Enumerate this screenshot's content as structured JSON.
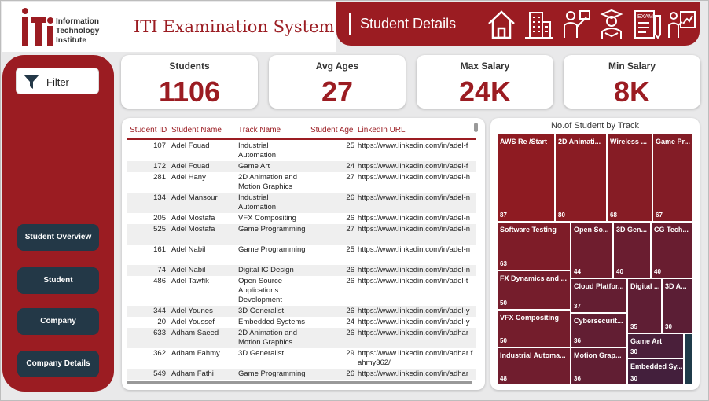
{
  "header": {
    "logo_text": [
      "Information",
      "Technology",
      "Institute"
    ],
    "app_title": "ITI Examination System",
    "page_title": "Student Details",
    "nav_icons": [
      "home-icon",
      "building-icon",
      "instructor-icon",
      "student-icon",
      "exam-icon",
      "presenter-icon"
    ]
  },
  "sidebar": {
    "filter_label": "Filter",
    "nav": [
      "Student Overview",
      "Student",
      "Company",
      "Company Details"
    ]
  },
  "kpis": [
    {
      "label": "Students",
      "value": "1106"
    },
    {
      "label": "Avg Ages",
      "value": "27"
    },
    {
      "label": "Max Salary",
      "value": "24K"
    },
    {
      "label": "Min Salary",
      "value": "8K"
    }
  ],
  "table": {
    "headers": [
      "Student ID",
      "Student Name",
      "Track Name",
      "Student Age",
      "LinkedIn URL"
    ],
    "rows": [
      {
        "id": "107",
        "name": "Adel Fouad",
        "track": "Industrial Automation",
        "age": "25",
        "url": "https://www.linkedin.com/in/adel-f"
      },
      {
        "id": "172",
        "name": "Adel Fouad",
        "track": "Game Art",
        "age": "24",
        "url": "https://www.linkedin.com/in/adel-f"
      },
      {
        "id": "281",
        "name": "Adel Hany",
        "track": "2D Animation and Motion Graphics",
        "age": "27",
        "url": "https://www.linkedin.com/in/adel-h"
      },
      {
        "id": "134",
        "name": "Adel Mansour",
        "track": "Industrial Automation",
        "age": "26",
        "url": "https://www.linkedin.com/in/adel-n"
      },
      {
        "id": "205",
        "name": "Adel Mostafa",
        "track": "VFX Compositing",
        "age": "26",
        "url": "https://www.linkedin.com/in/adel-n"
      },
      {
        "id": "525",
        "name": "Adel Mostafa",
        "track": "Game Programming",
        "age": "27",
        "url": "https://www.linkedin.com/in/adel-n"
      },
      {
        "id": "161",
        "name": "Adel Nabil",
        "track": "Game Programming",
        "age": "25",
        "url": "https://www.linkedin.com/in/adel-n"
      },
      {
        "id": "74",
        "name": "Adel Nabil",
        "track": "Digital IC Design",
        "age": "26",
        "url": "https://www.linkedin.com/in/adel-n"
      },
      {
        "id": "486",
        "name": "Adel Tawfik",
        "track": "Open Source Applications Development",
        "age": "26",
        "url": "https://www.linkedin.com/in/adel-t"
      },
      {
        "id": "344",
        "name": "Adel Younes",
        "track": "3D Generalist",
        "age": "26",
        "url": "https://www.linkedin.com/in/adel-y"
      },
      {
        "id": "20",
        "name": "Adel Youssef",
        "track": "Embedded Systems",
        "age": "24",
        "url": "https://www.linkedin.com/in/adel-y"
      },
      {
        "id": "633",
        "name": "Adham Saeed",
        "track": "2D Animation and Motion Graphics",
        "age": "26",
        "url": "https://www.linkedin.com/in/adhar"
      },
      {
        "id": "362",
        "name": "Adham Fahmy",
        "track": "3D Generalist",
        "age": "29",
        "url": "https://www.linkedin.com/in/adhar fahmy362/"
      },
      {
        "id": "549",
        "name": "Adham Fathi",
        "track": "Game Programming",
        "age": "26",
        "url": "https://www.linkedin.com/in/adhar"
      }
    ]
  },
  "chart_data": {
    "type": "treemap",
    "title": "No.of Student by Track",
    "cells": [
      {
        "label": "AWS Re /Start",
        "value": 87,
        "color": "#8e1b22"
      },
      {
        "label": "2D Animati...",
        "value": 80,
        "color": "#8a1c24"
      },
      {
        "label": "Wireless ...",
        "value": 68,
        "color": "#861c25"
      },
      {
        "label": "Game Pr...",
        "value": 67,
        "color": "#831c26"
      },
      {
        "label": "Software Testing",
        "value": 63,
        "color": "#7e1c28"
      },
      {
        "label": "Open So...",
        "value": 44,
        "color": "#6f1d2e"
      },
      {
        "label": "3D Gen...",
        "value": 40,
        "color": "#6a1d30"
      },
      {
        "label": "CG Tech...",
        "value": 40,
        "color": "#691d30"
      },
      {
        "label": "FX Dynamics and ...",
        "value": 50,
        "color": "#751d2c"
      },
      {
        "label": "Cloud Platfor...",
        "value": 37,
        "color": "#641e32"
      },
      {
        "label": "Digital ...",
        "value": 35,
        "color": "#5f1e34"
      },
      {
        "label": "3D A...",
        "value": 30,
        "color": "#5b1e35"
      },
      {
        "label": "VFX Compositing",
        "value": 50,
        "color": "#741d2c"
      },
      {
        "label": "Cybersecurit...",
        "value": 36,
        "color": "#621e33"
      },
      {
        "label": "Game Art",
        "value": 30,
        "color": "#4a1f3a"
      },
      {
        "label": "Industrial Automa...",
        "value": 48,
        "color": "#701d2e"
      },
      {
        "label": "Motion Grap...",
        "value": 36,
        "color": "#611e33"
      },
      {
        "label": "Embedded Sy...",
        "value": 30,
        "color": "#431f3c"
      }
    ]
  }
}
